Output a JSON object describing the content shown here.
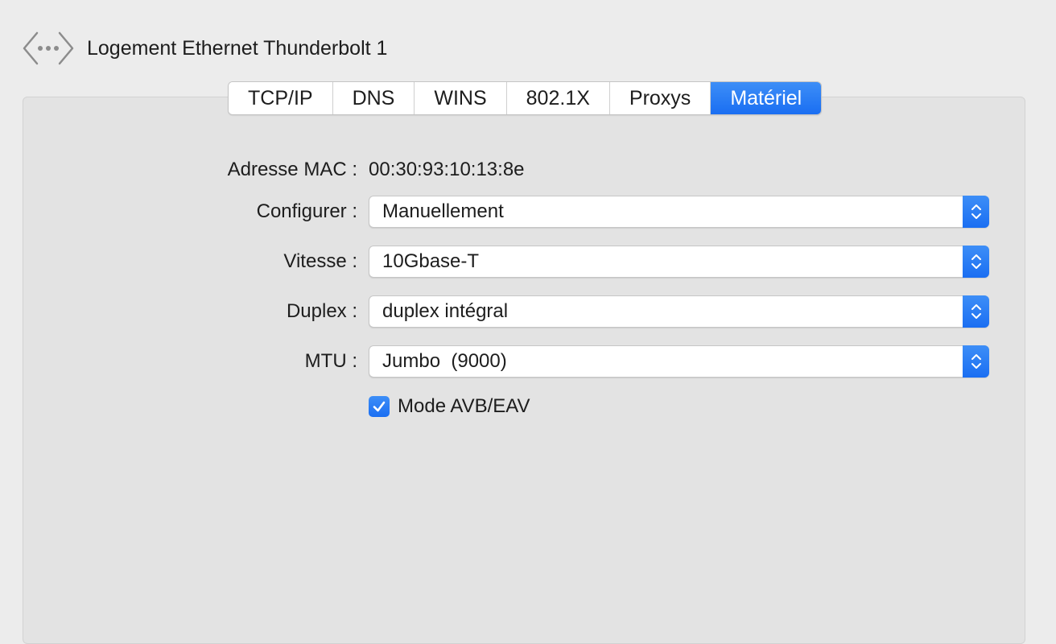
{
  "header": {
    "title": "Logement Ethernet Thunderbolt 1",
    "icon": "network-interface-icon"
  },
  "tabs": [
    {
      "label": "TCP/IP",
      "active": false
    },
    {
      "label": "DNS",
      "active": false
    },
    {
      "label": "WINS",
      "active": false
    },
    {
      "label": "802.1X",
      "active": false
    },
    {
      "label": "Proxys",
      "active": false
    },
    {
      "label": "Matériel",
      "active": true
    }
  ],
  "hardware": {
    "mac_label": "Adresse MAC :",
    "mac_value": "00:30:93:10:13:8e",
    "configure_label": "Configurer :",
    "configure_value": "Manuellement",
    "speed_label": "Vitesse :",
    "speed_value": "10Gbase-T",
    "duplex_label": "Duplex :",
    "duplex_value": "duplex intégral",
    "mtu_label": "MTU :",
    "mtu_value": "Jumbo  (9000)",
    "avb_label": "Mode AVB/EAV",
    "avb_checked": true
  },
  "colors": {
    "accent": "#1a6ef2",
    "background": "#ececec",
    "panel": "#e3e3e3"
  }
}
